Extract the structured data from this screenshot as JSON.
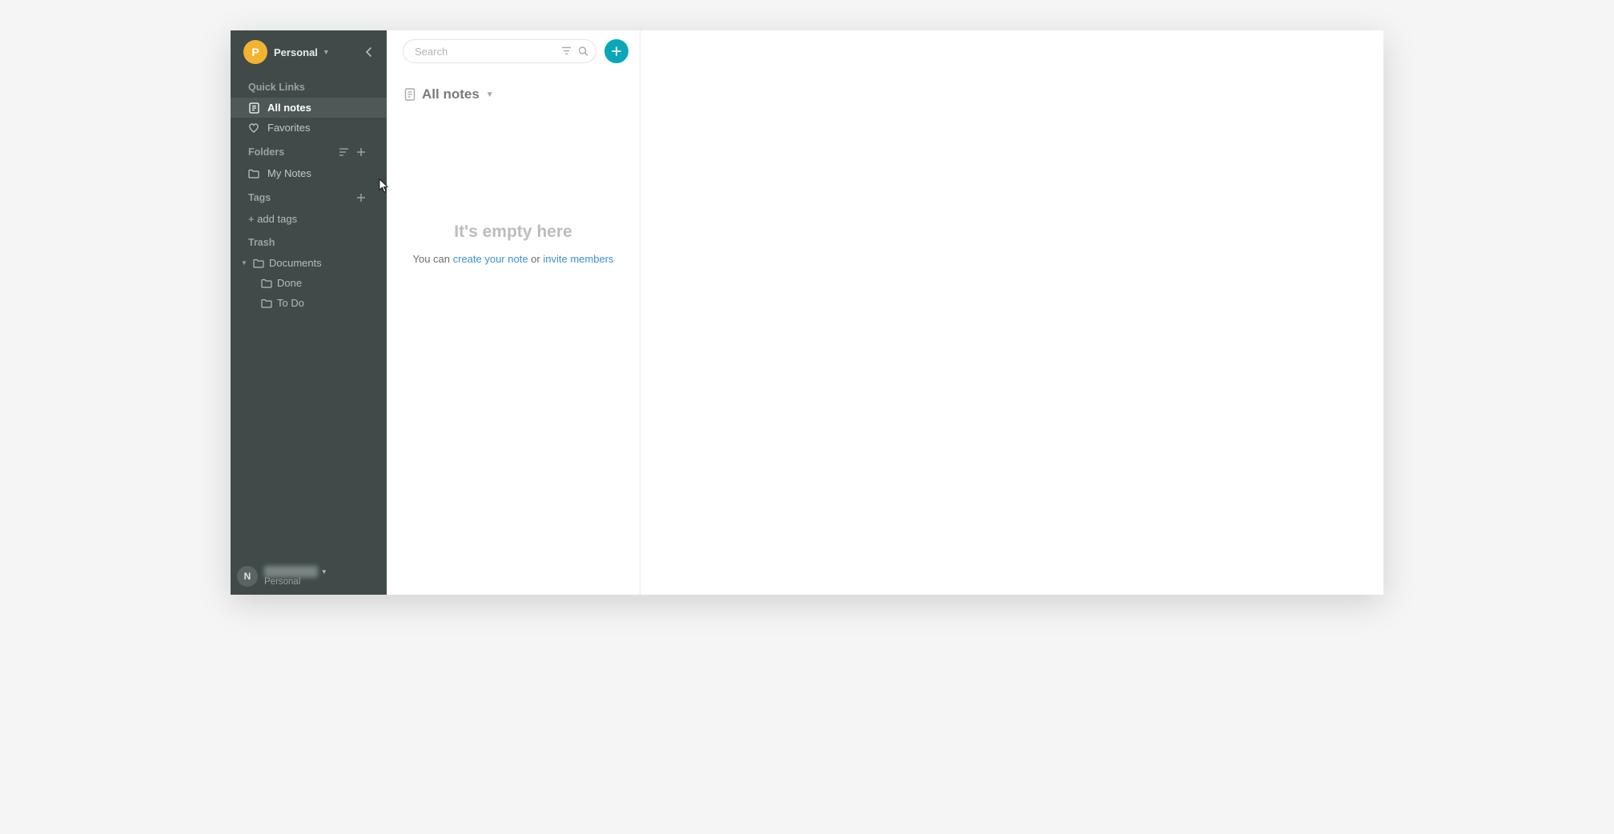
{
  "workspace": {
    "avatar_letter": "P",
    "name": "Personal"
  },
  "sidebar": {
    "quick_links_label": "Quick Links",
    "all_notes_label": "All notes",
    "favorites_label": "Favorites",
    "folders_label": "Folders",
    "my_notes_label": "My Notes",
    "tags_label": "Tags",
    "add_tags_label": "+ add tags",
    "trash_label": "Trash",
    "trash_items": {
      "documents": "Documents",
      "done": "Done",
      "todo": "To Do"
    }
  },
  "user": {
    "avatar_letter": "N",
    "name_redacted": "████ ███",
    "plan": "Personal"
  },
  "search": {
    "placeholder": "Search"
  },
  "list": {
    "title": "All notes"
  },
  "empty": {
    "title": "It's empty here",
    "prefix": "You can ",
    "create_link": "create your note",
    "middle": " or ",
    "invite_link": "invite members"
  }
}
